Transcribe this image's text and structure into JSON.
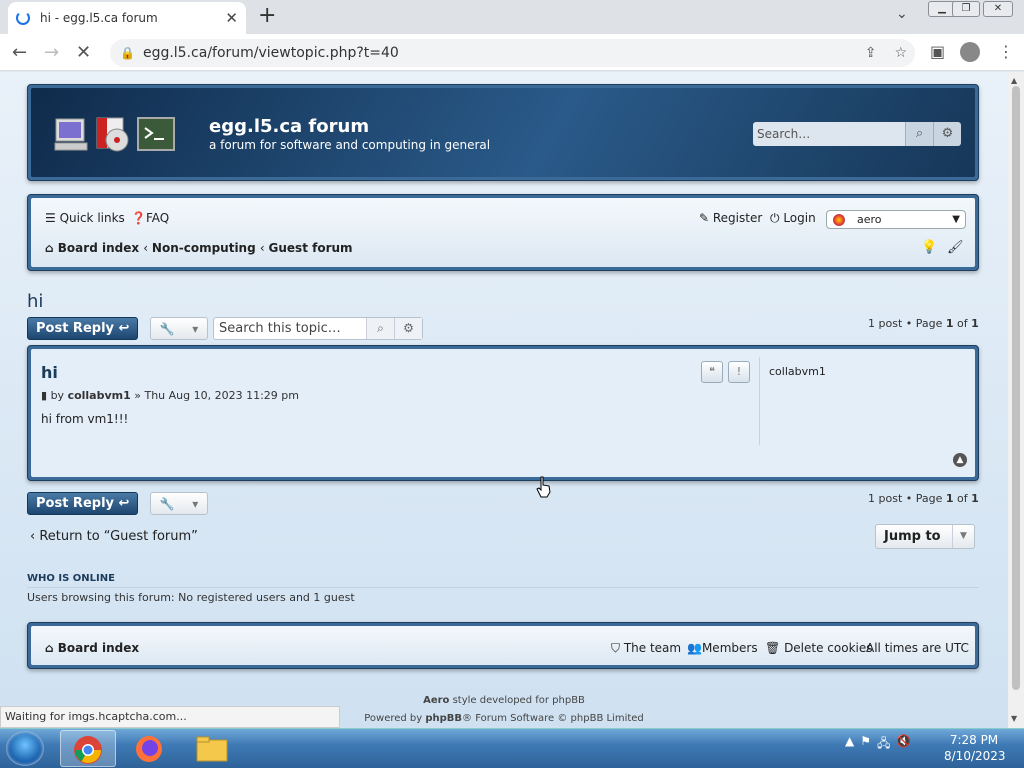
{
  "browser": {
    "tab_title": "hi - egg.l5.ca forum",
    "url": "egg.l5.ca/forum/viewtopic.php?t=40"
  },
  "header": {
    "site_name": "egg.l5.ca forum",
    "site_desc": "a forum for software and computing in general",
    "search_placeholder": "Search…"
  },
  "navbar": {
    "quick_links": "Quick links",
    "faq": "FAQ",
    "register": "Register",
    "login": "Login",
    "style_value": "aero",
    "breadcrumb": [
      "Board index",
      "Non-computing",
      "Guest forum"
    ]
  },
  "topic": {
    "title": "hi",
    "post_reply": "Post Reply",
    "search_placeholder": "Search this topic…",
    "pagination": {
      "prefix": "1 post • Page ",
      "page": "1",
      "of": " of ",
      "total": "1"
    }
  },
  "post": {
    "subject": "hi",
    "by": "by ",
    "author": "collabvm1",
    "date": " » Thu Aug 10, 2023 11:29 pm",
    "content": "hi from vm1!!!",
    "profile_name": "collabvm1"
  },
  "actions": {
    "return_link": "Return to “Guest forum”",
    "jump_to": "Jump to"
  },
  "who_is_online": {
    "heading": "WHO IS ONLINE",
    "text": "Users browsing this forum: No registered users and 1 guest"
  },
  "footer": {
    "board_index": "Board index",
    "team": "The team",
    "members": "Members",
    "delete_cookies": "Delete cookies",
    "times": "All times are UTC"
  },
  "credits": {
    "style_name": "Aero",
    "style_text": " style developed for phpBB",
    "powered_prefix": "Powered by ",
    "powered_name": "phpBB",
    "powered_suffix": "® Forum Software © phpBB Limited"
  },
  "status_bar": "Waiting for imgs.hcaptcha.com...",
  "taskbar": {
    "time": "7:28 PM",
    "date": "8/10/2023"
  }
}
